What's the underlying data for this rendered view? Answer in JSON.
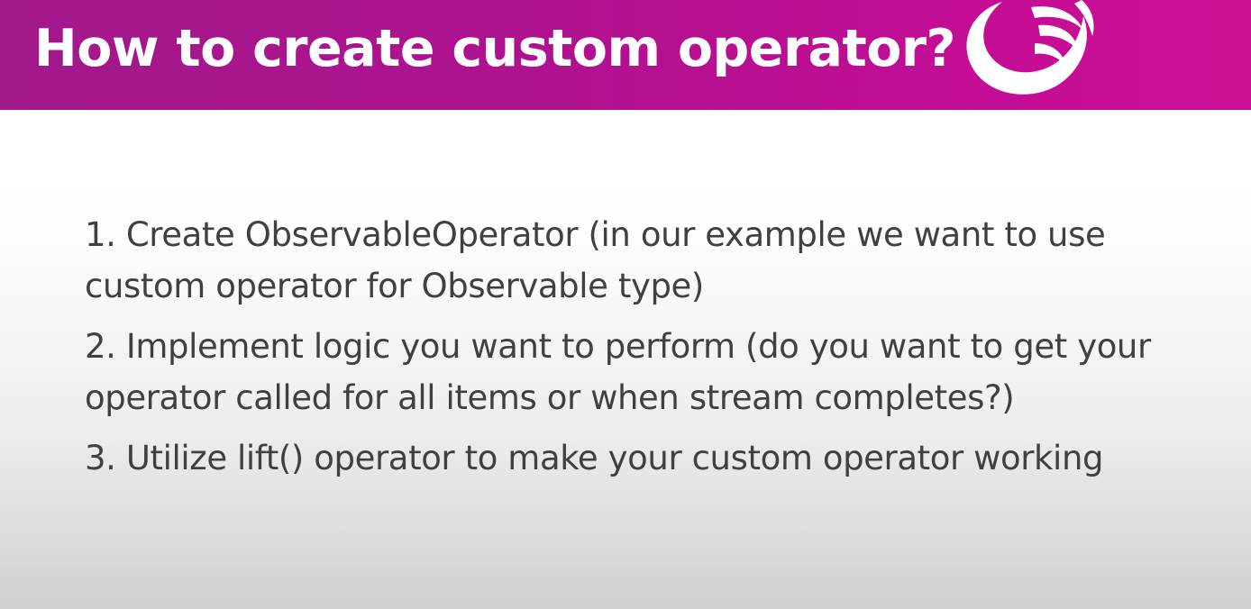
{
  "slide": {
    "title": "How to create custom operator?",
    "logo_icon": "reactivex-logo",
    "colors": {
      "header_gradient_start": "#a1198b",
      "header_gradient_end": "#cc1196",
      "title_text": "#ffffff",
      "body_text": "#404040"
    },
    "points": [
      {
        "text": "1. Create ObservableOperator (in our example we want to use custom operator for Observable type)"
      },
      {
        "text": "2. Implement logic you want to perform (do you want to get your operator called for all items or when stream completes?)"
      },
      {
        "text": "3. Utilize lift() operator to make your custom operator working"
      }
    ]
  }
}
